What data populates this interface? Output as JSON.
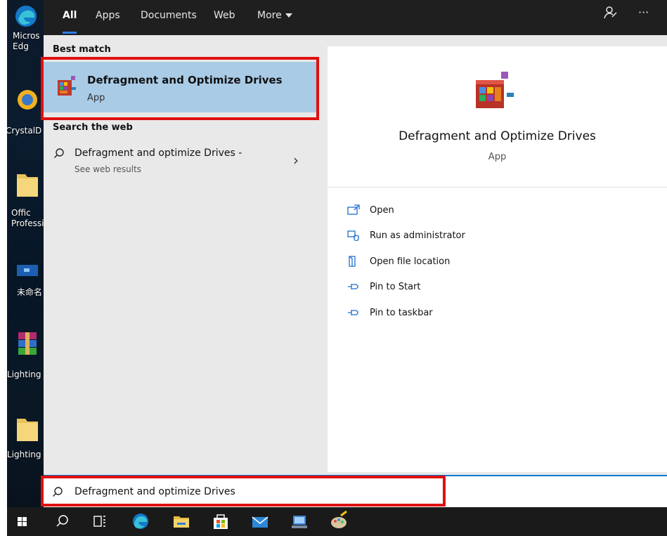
{
  "desktop": {
    "icons": [
      {
        "label": "Micros\nEdg",
        "name": "microsoft-edge"
      },
      {
        "label": "CrystalD",
        "name": "crystaldisk"
      },
      {
        "label": "Offic\nProfessi",
        "name": "office-professional"
      },
      {
        "label": "未命名",
        "name": "untitled"
      },
      {
        "label": "Lighting",
        "name": "lighting-1"
      },
      {
        "label": "Lighting",
        "name": "lighting-2"
      }
    ]
  },
  "tabs": [
    {
      "label": "All",
      "active": true
    },
    {
      "label": "Apps"
    },
    {
      "label": "Documents"
    },
    {
      "label": "Web"
    },
    {
      "label": "More"
    }
  ],
  "top_icons": {
    "feedback": "feedback-icon",
    "more": "···"
  },
  "left": {
    "best_match_heading": "Best match",
    "best_match": {
      "title": "Defragment and Optimize Drives",
      "subtitle": "App"
    },
    "web_heading": "Search the web",
    "web_result": {
      "title": "Defragment and optimize Drives -",
      "subtitle": "See web results"
    }
  },
  "right": {
    "title": "Defragment and Optimize Drives",
    "subtitle": "App",
    "actions": [
      {
        "label": "Open",
        "icon": "open-icon"
      },
      {
        "label": "Run as administrator",
        "icon": "shield-icon"
      },
      {
        "label": "Open file location",
        "icon": "folder-location-icon"
      },
      {
        "label": "Pin to Start",
        "icon": "pin-icon"
      },
      {
        "label": "Pin to taskbar",
        "icon": "pin-icon"
      }
    ]
  },
  "search": {
    "value": "Defragment and optimize Drives"
  },
  "colors": {
    "accent": "#0078d4",
    "selection": "#a9cbe6",
    "annotation": "#e01010",
    "topbar": "#1f1f1f"
  }
}
